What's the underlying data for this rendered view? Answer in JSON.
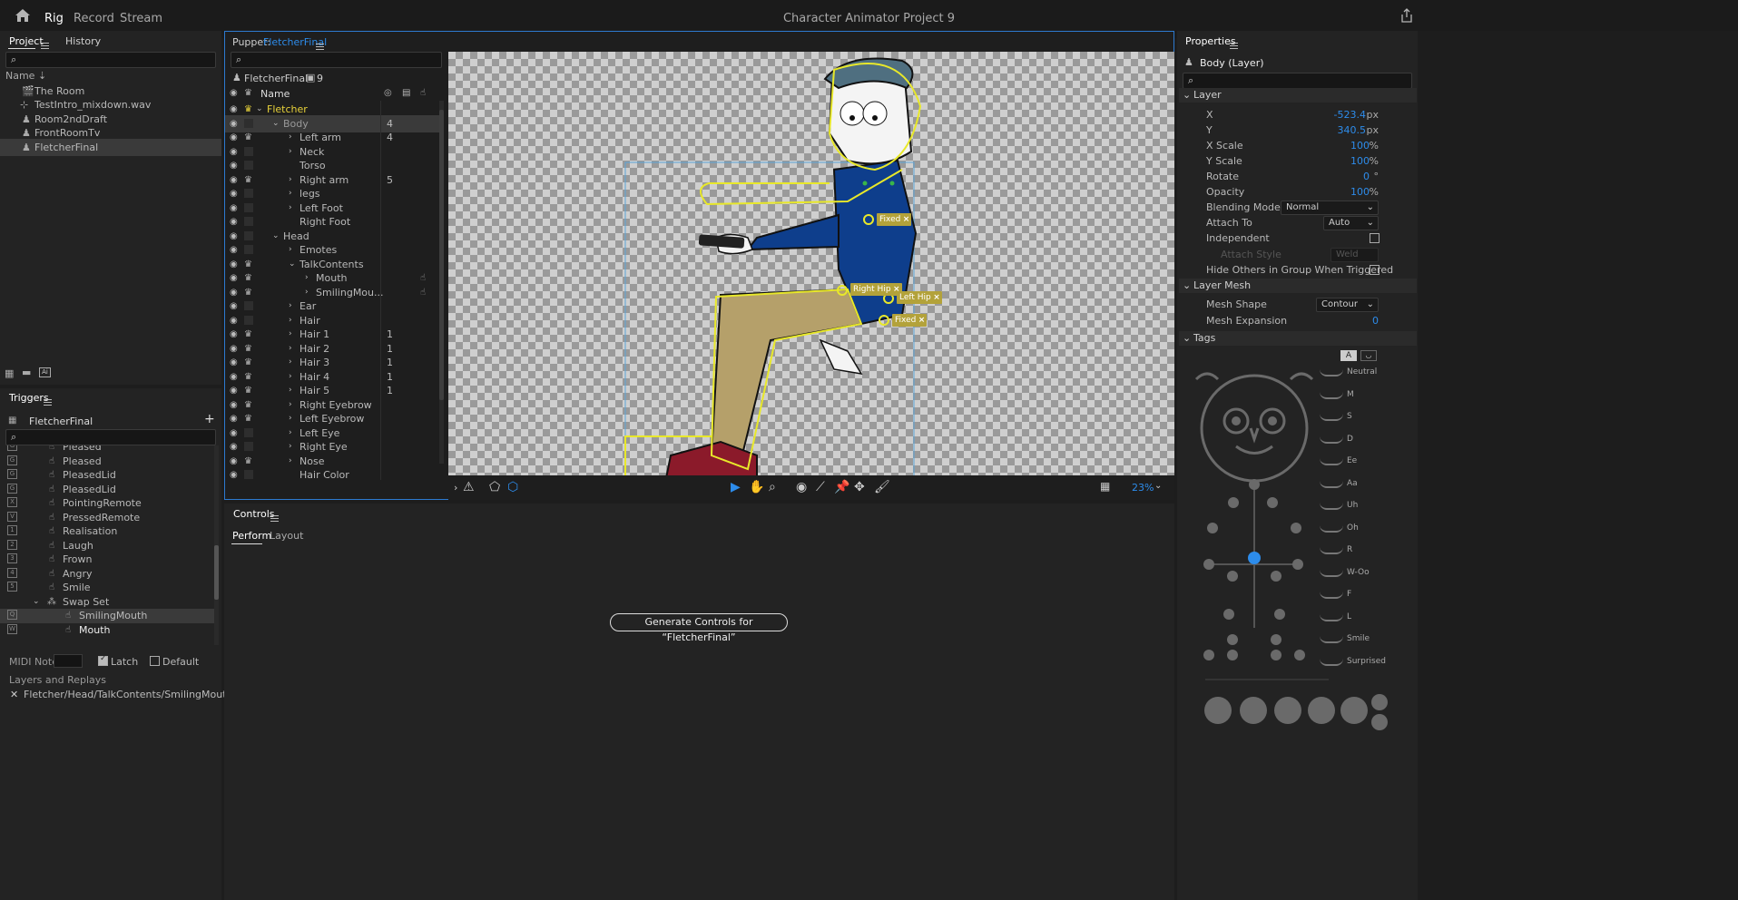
{
  "topbar": {
    "title": "Character Animator Project 9",
    "tabs": [
      "Rig",
      "Record",
      "Stream"
    ]
  },
  "project": {
    "tabs": [
      "Project",
      "History"
    ],
    "sort_label": "Name",
    "items": [
      "The Room",
      "TestIntro_mixdown.wav",
      "Room2ndDraft",
      "FrontRoomTv",
      "FletcherFinal"
    ]
  },
  "triggers": {
    "title": "Triggers",
    "puppet": "FletcherFinal",
    "rows": [
      {
        "key": "G",
        "name": "Pleased"
      },
      {
        "key": "G",
        "name": "Pleased"
      },
      {
        "key": "G",
        "name": "PleasedLid"
      },
      {
        "key": "G",
        "name": "PleasedLid"
      },
      {
        "key": "X",
        "name": "PointingRemote"
      },
      {
        "key": "V",
        "name": "PressedRemote"
      },
      {
        "key": "1",
        "name": "Realisation"
      },
      {
        "key": "2",
        "name": "Laugh"
      },
      {
        "key": "3",
        "name": "Frown"
      },
      {
        "key": "4",
        "name": "Angry"
      },
      {
        "key": "5",
        "name": "Smile"
      },
      {
        "key": "",
        "name": "Swap Set"
      },
      {
        "key": "Q",
        "name": "SmilingMouth"
      },
      {
        "key": "W",
        "name": "Mouth"
      }
    ],
    "midi_label": "MIDI Note",
    "latch_label": "Latch",
    "default_label": "Default",
    "layers_label": "Layers and Replays",
    "layer_path": "Fletcher/Head/TalkContents/SmilingMouth"
  },
  "puppet": {
    "label": "Puppet:",
    "name": "FletcherFinal",
    "header_name": "FletcherFinal",
    "count": "9",
    "col_name": "Name",
    "layers": [
      {
        "name": "Fletcher",
        "indent": 0,
        "num": "",
        "crown": true,
        "expand": "v"
      },
      {
        "name": "Body",
        "indent": 1,
        "num": "4",
        "crown": false,
        "expand": "v"
      },
      {
        "name": "Left arm",
        "indent": 2,
        "num": "4",
        "crown": true,
        "expand": ">"
      },
      {
        "name": "Neck",
        "indent": 2,
        "num": "",
        "crown": false,
        "expand": ">"
      },
      {
        "name": "Torso",
        "indent": 2,
        "num": "",
        "crown": false,
        "expand": ""
      },
      {
        "name": "Right arm",
        "indent": 2,
        "num": "5",
        "crown": true,
        "expand": ">"
      },
      {
        "name": "legs",
        "indent": 2,
        "num": "",
        "crown": false,
        "expand": ">"
      },
      {
        "name": "Left Foot",
        "indent": 2,
        "num": "",
        "crown": false,
        "expand": ">"
      },
      {
        "name": "Right Foot",
        "indent": 2,
        "num": "",
        "crown": false,
        "expand": ""
      },
      {
        "name": "Head",
        "indent": 1,
        "num": "",
        "crown": false,
        "expand": "v"
      },
      {
        "name": "Emotes",
        "indent": 2,
        "num": "",
        "crown": false,
        "expand": ">"
      },
      {
        "name": "TalkContents",
        "indent": 2,
        "num": "",
        "crown": true,
        "expand": "v"
      },
      {
        "name": "Mouth",
        "indent": 3,
        "num": "",
        "crown": true,
        "expand": ">"
      },
      {
        "name": "SmilingMou...",
        "indent": 3,
        "num": "",
        "crown": true,
        "expand": ">"
      },
      {
        "name": "Ear",
        "indent": 2,
        "num": "",
        "crown": false,
        "expand": ">"
      },
      {
        "name": "Hair",
        "indent": 2,
        "num": "",
        "crown": false,
        "expand": ">"
      },
      {
        "name": "Hair 1",
        "indent": 2,
        "num": "1",
        "crown": true,
        "expand": ">"
      },
      {
        "name": "Hair 2",
        "indent": 2,
        "num": "1",
        "crown": true,
        "expand": ">"
      },
      {
        "name": "Hair 3",
        "indent": 2,
        "num": "1",
        "crown": true,
        "expand": ">"
      },
      {
        "name": "Hair 4",
        "indent": 2,
        "num": "1",
        "crown": true,
        "expand": ">"
      },
      {
        "name": "Hair 5",
        "indent": 2,
        "num": "1",
        "crown": true,
        "expand": ">"
      },
      {
        "name": "Right Eyebrow",
        "indent": 2,
        "num": "",
        "crown": true,
        "expand": ">"
      },
      {
        "name": "Left Eyebrow",
        "indent": 2,
        "num": "",
        "crown": true,
        "expand": ">"
      },
      {
        "name": "Left Eye",
        "indent": 2,
        "num": "",
        "crown": false,
        "expand": ">"
      },
      {
        "name": "Right Eye",
        "indent": 2,
        "num": "",
        "crown": false,
        "expand": ">"
      },
      {
        "name": "Nose",
        "indent": 2,
        "num": "",
        "crown": true,
        "expand": ">"
      },
      {
        "name": "Hair Color",
        "indent": 2,
        "num": "",
        "crown": false,
        "expand": ""
      }
    ],
    "handles": [
      "Fixed",
      "Right Hip",
      "Left Hip",
      "Fixed"
    ],
    "zoom": "23%"
  },
  "controls": {
    "title": "Controls",
    "tabs": [
      "Perform",
      "Layout"
    ],
    "generate_button": "Generate Controls for “FletcherFinal”"
  },
  "properties": {
    "title": "Properties",
    "layer_name": "Body (Layer)",
    "section_layer": "Layer",
    "x_label": "X",
    "x_val": "-523.4",
    "x_unit": "px",
    "y_label": "Y",
    "y_val": "340.5",
    "y_unit": "px",
    "xs_label": "X Scale",
    "xs_val": "100",
    "xs_unit": "%",
    "ys_label": "Y Scale",
    "ys_val": "100",
    "ys_unit": "%",
    "rot_label": "Rotate",
    "rot_val": "0",
    "rot_unit": "°",
    "op_label": "Opacity",
    "op_val": "100",
    "op_unit": "%",
    "blend_label": "Blending Mode",
    "blend_val": "Normal",
    "attach_label": "Attach To",
    "attach_val": "Auto",
    "indep_label": "Independent",
    "attach_style_label": "Attach Style",
    "attach_style_val": "Weld",
    "hide_label": "Hide Others in Group When Triggered",
    "section_mesh": "Layer Mesh",
    "mesh_shape_label": "Mesh Shape",
    "mesh_shape_val": "Contour",
    "mesh_exp_label": "Mesh Expansion",
    "mesh_exp_val": "0",
    "section_tags": "Tags",
    "tag_mode": "A",
    "visemes": [
      "Neutral",
      "M",
      "S",
      "D",
      "Ee",
      "Aa",
      "Uh",
      "Oh",
      "R",
      "W-Oo",
      "F",
      "L",
      "Smile",
      "Surprised"
    ]
  },
  "colors": {
    "accent": "#2d8ceb",
    "handle": "#b3a23a",
    "selection": "#e8e82a"
  }
}
